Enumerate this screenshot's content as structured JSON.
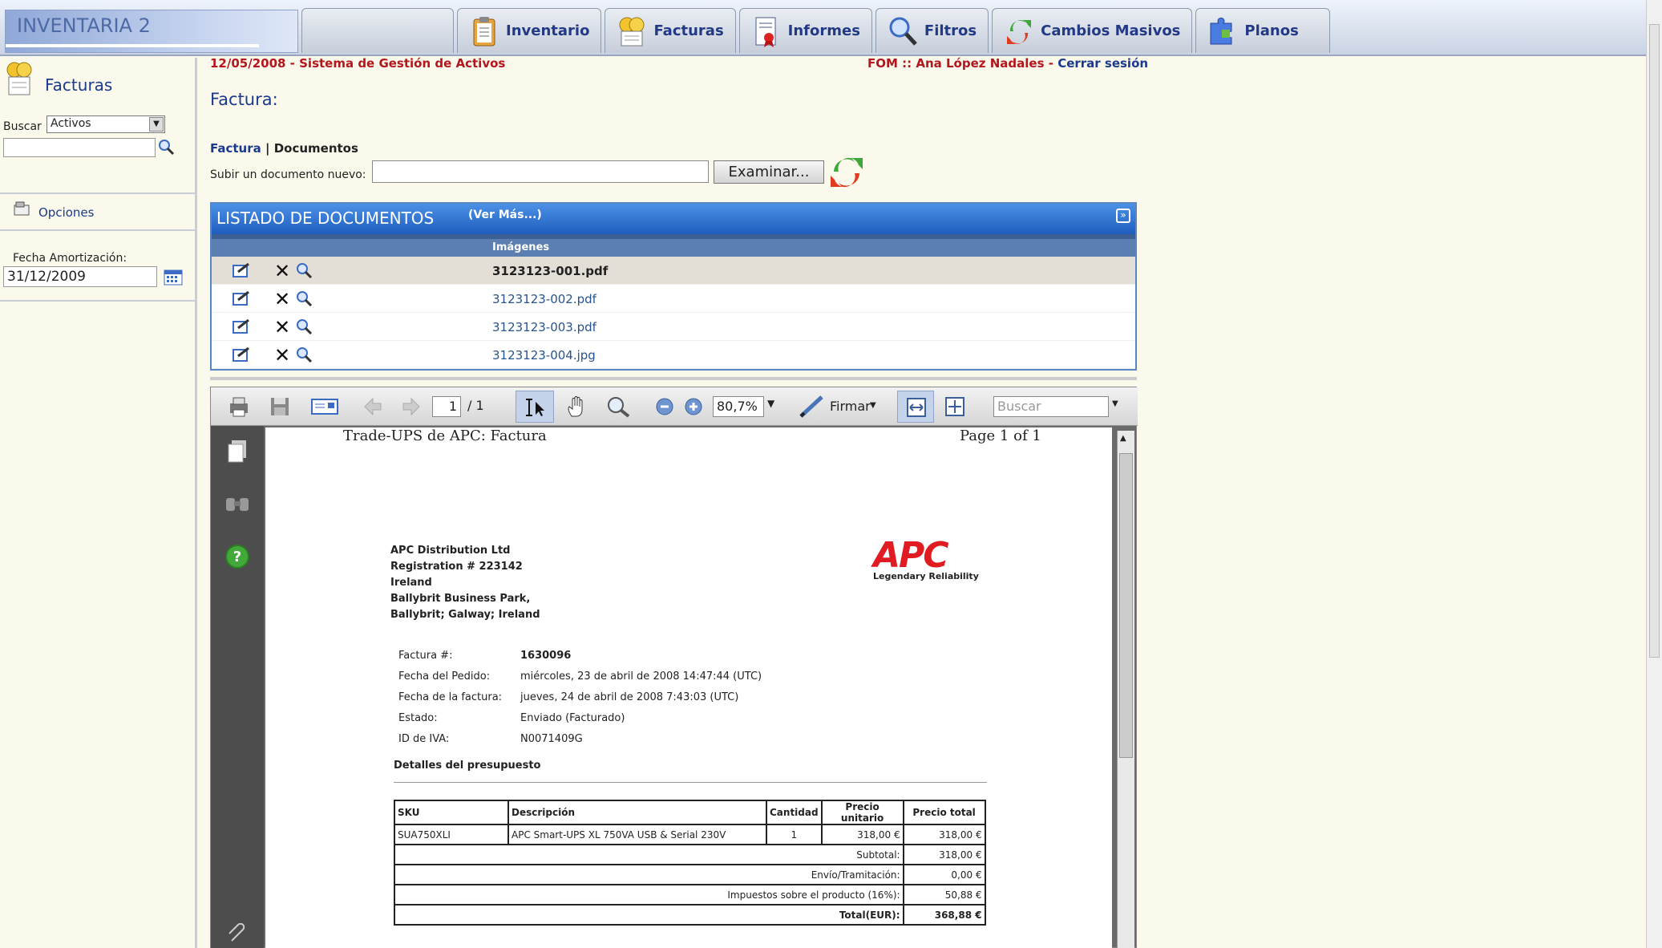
{
  "app": {
    "title": "INVENTARIA 2"
  },
  "nav": {
    "tabs": [
      {
        "label": "Inventario",
        "icon": "clipboard-icon"
      },
      {
        "label": "Facturas",
        "icon": "coins-icon"
      },
      {
        "label": "Informes",
        "icon": "report-icon"
      },
      {
        "label": "Filtros",
        "icon": "magnifier-icon"
      },
      {
        "label": "Cambios Masivos",
        "icon": "refresh-arrows-icon"
      },
      {
        "label": "Planos",
        "icon": "puzzle-icon"
      }
    ]
  },
  "sidebar": {
    "title": "Facturas",
    "buscar_label": "Buscar",
    "buscar_selected": "Activos",
    "opciones_label": "Opciones",
    "fecha_label": "Fecha Amortización:",
    "fecha_value": "31/12/2009"
  },
  "header": {
    "date": "12/05/2008",
    "separator": " - ",
    "system": "Sistema de Gestión de Activos",
    "user": "FOM :: Ana López Nadales",
    "logout": "Cerrar sesión"
  },
  "main": {
    "heading": "Factura:",
    "subtabs": {
      "factura": "Factura",
      "sep": " | ",
      "documentos": "Documentos"
    },
    "upload_label": "Subir un documento nuevo:",
    "upload_button": "Examinar..."
  },
  "docs": {
    "title": "LISTADO DE DOCUMENTOS",
    "more": "(Ver Más...)",
    "column": "Imágenes",
    "rows": [
      {
        "name": "3123123-001.pdf"
      },
      {
        "name": "3123123-002.pdf"
      },
      {
        "name": "3123123-003.pdf"
      },
      {
        "name": "3123123-004.jpg"
      }
    ]
  },
  "viewer": {
    "page_current": "1",
    "page_total": "/ 1",
    "zoom": "80,7%",
    "sign_label": "Firmar",
    "search_placeholder": "Buscar"
  },
  "invoice": {
    "title": "Trade-UPS de APC: Factura",
    "page": "Page 1 of 1",
    "company_lines": [
      "APC Distribution Ltd",
      "Registration # 223142",
      "Ireland",
      "Ballybrit Business Park,",
      "Ballybrit; Galway; Ireland"
    ],
    "logo_text": "APC",
    "logo_tagline": "Legendary Reliability",
    "meta": [
      {
        "k": "Factura #:",
        "v": "1630096"
      },
      {
        "k": "Fecha del Pedido:",
        "v": "miércoles, 23 de abril de 2008 14:47:44 (UTC)"
      },
      {
        "k": "Fecha de la factura:",
        "v": "jueves, 24 de abril de 2008 7:43:03 (UTC)"
      },
      {
        "k": "Estado:",
        "v": "Enviado (Facturado)"
      },
      {
        "k": "ID de IVA:",
        "v": "N0071409G"
      }
    ],
    "details_title": "Detalles del presupuesto",
    "table_head": {
      "sku": "SKU",
      "desc": "Descripción",
      "qty": "Cantidad",
      "unit": "Precio unitario",
      "total": "Precio total"
    },
    "item": {
      "sku": "SUA750XLI",
      "desc": "APC Smart-UPS XL 750VA USB & Serial 230V",
      "qty": "1",
      "unit": "318,00 €",
      "total": "318,00 €"
    },
    "summary": [
      {
        "k": "Subtotal:",
        "v": "318,00 €"
      },
      {
        "k": "Envío/Tramitación:",
        "v": "0,00 €"
      },
      {
        "k": "Impuestos sobre el producto (16%):",
        "v": "50,88 €"
      },
      {
        "k": "Total(EUR):",
        "v": "368,88 €"
      }
    ]
  }
}
